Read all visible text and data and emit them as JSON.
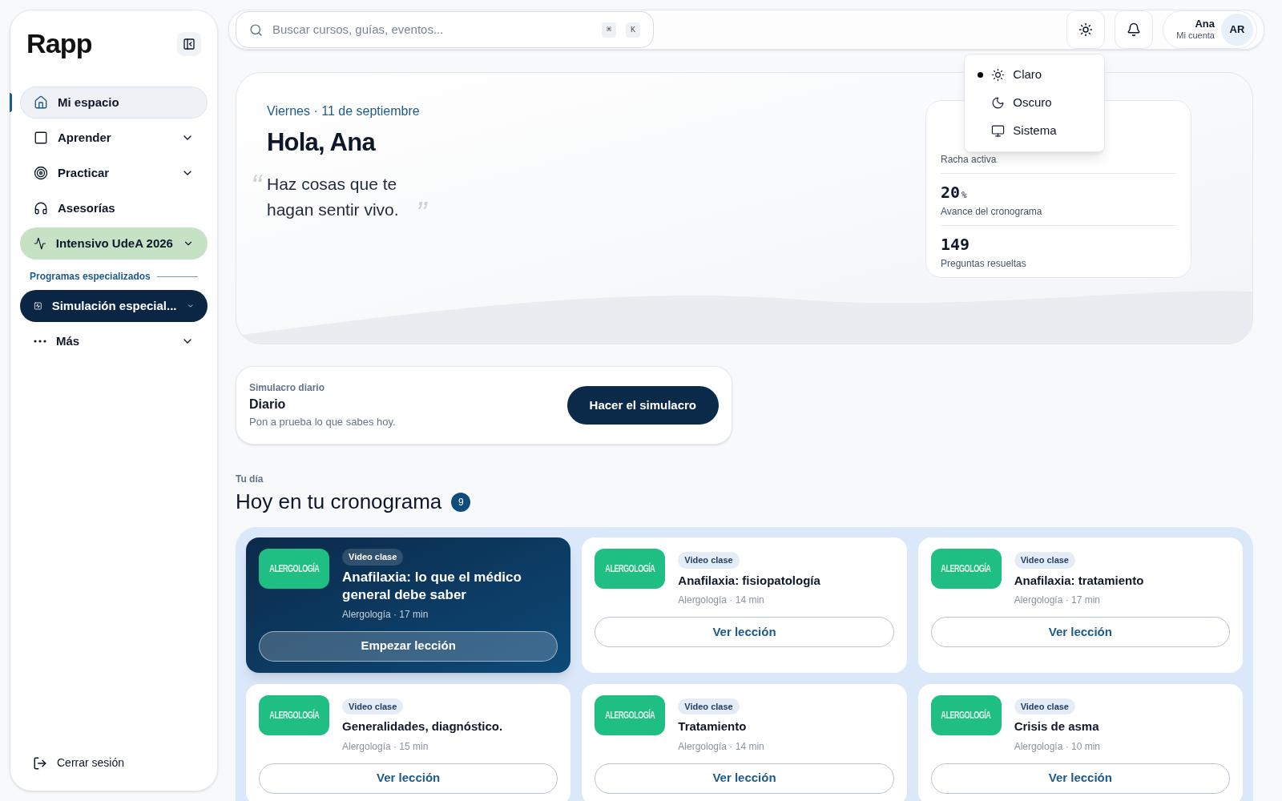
{
  "sidebar": {
    "logo": "Rapp",
    "items": [
      {
        "label": "Mi espacio",
        "kind": "plain",
        "selected": true,
        "expandable": false
      },
      {
        "label": "Aprender",
        "kind": "plain",
        "selected": false,
        "expandable": true
      },
      {
        "label": "Practicar",
        "kind": "plain",
        "selected": false,
        "expandable": true
      },
      {
        "label": "Asesorías",
        "kind": "plain",
        "selected": false,
        "expandable": false
      },
      {
        "label": "Intensivo UdeA 2026",
        "kind": "program",
        "selected": false,
        "expandable": true
      },
      {
        "label": "Simulación especial...",
        "kind": "special",
        "selected": false,
        "expandable": true
      },
      {
        "label": "Más",
        "kind": "plain",
        "selected": false,
        "expandable": true
      }
    ],
    "section_heading": "Programas especializados",
    "logout": "Cerrar sesión"
  },
  "topbar": {
    "search": {
      "placeholder": "Buscar cursos, guías, eventos...",
      "keys": [
        "⌘",
        "K"
      ]
    },
    "account": {
      "name": "Ana",
      "subtitle": "Mi cuenta",
      "initials": "AR"
    },
    "theme_menu": [
      {
        "label": "Claro",
        "selected": true
      },
      {
        "label": "Oscuro",
        "selected": false
      },
      {
        "label": "Sistema",
        "selected": false
      }
    ]
  },
  "hero": {
    "date": "Viernes · 11 de septiembre",
    "greeting": "Hola, Ana",
    "quote_open": "“",
    "quote": "Haz cosas que te hagan sentir vivo.",
    "quote_close": "”",
    "stats": [
      {
        "label": "Racha activa"
      },
      {
        "value": "20",
        "unit": "%",
        "label": "Avance del cronograma"
      },
      {
        "value": "149",
        "label": "Preguntas resueltas"
      }
    ]
  },
  "daily": {
    "eyebrow": "Simulacro diario",
    "title": "Diario",
    "subtitle": "Pon a prueba lo que sabes hoy.",
    "button": "Hacer el simulacro"
  },
  "schedule": {
    "eyebrow": "Tu día",
    "title": "Hoy en tu cronograma",
    "count": "9",
    "lessons": [
      {
        "kind": "featured",
        "thumb": "ALERGOLOGÍA",
        "tag": "Video clase",
        "title": "Anafilaxia: lo que el médico general debe saber",
        "meta": "Alergología · 17 min",
        "button": "Empezar lección"
      },
      {
        "kind": "normal",
        "thumb": "ALERGOLOGÍA",
        "tag": "Video clase",
        "title": "Anafilaxia: fisiopatología",
        "meta": "Alergología · 14 min",
        "button": "Ver lección"
      },
      {
        "kind": "normal",
        "thumb": "ALERGOLOGÍA",
        "tag": "Video clase",
        "title": "Anafilaxia: tratamiento",
        "meta": "Alergología · 17 min",
        "button": "Ver lección"
      },
      {
        "kind": "normal",
        "thumb": "ALERGOLOGÍA",
        "tag": "Video clase",
        "title": "Generalidades, diagnóstico.",
        "meta": "Alergología · 15 min",
        "button": "Ver lección"
      },
      {
        "kind": "normal",
        "thumb": "ALERGOLOGÍA",
        "tag": "Video clase",
        "title": "Tratamiento",
        "meta": "Alergología · 14 min",
        "button": "Ver lección"
      },
      {
        "kind": "normal",
        "thumb": "ALERGOLOGÍA",
        "tag": "Video clase",
        "title": "Crisis de asma",
        "meta": "Alergología · 10 min",
        "button": "Ver lección"
      }
    ]
  }
}
